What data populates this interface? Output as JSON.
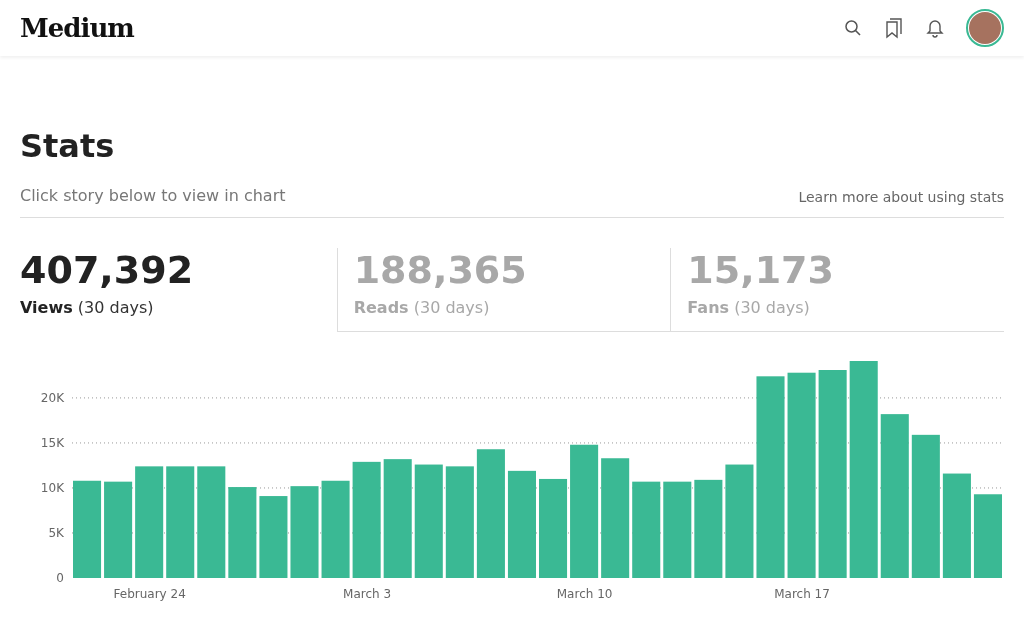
{
  "header": {
    "logo": "Medium"
  },
  "page": {
    "title": "Stats",
    "hint": "Click story below to view in chart",
    "learn_more": "Learn more about using stats"
  },
  "tabs": [
    {
      "value": "407,392",
      "label": "Views",
      "period": "(30 days)",
      "selected": true
    },
    {
      "value": "188,365",
      "label": "Reads",
      "period": "(30 days)",
      "selected": false
    },
    {
      "value": "15,173",
      "label": "Fans",
      "period": "(30 days)",
      "selected": false
    }
  ],
  "chart_data": {
    "type": "bar",
    "grid": true,
    "categories": [
      null,
      null,
      "February 24",
      null,
      null,
      null,
      null,
      null,
      null,
      "March 3",
      null,
      null,
      null,
      null,
      null,
      null,
      "March 10",
      null,
      null,
      null,
      null,
      null,
      null,
      "March 17",
      null,
      null,
      null,
      null,
      null,
      null
    ],
    "ylim": [
      0,
      24.1
    ],
    "series": [
      {
        "color": "#3ab994",
        "values": [
          10.8,
          10.7,
          12.4,
          12.4,
          12.4,
          10.1,
          9.1,
          10.2,
          10.8,
          12.9,
          13.2,
          12.6,
          12.4,
          14.3,
          11.9,
          11.0,
          14.8,
          13.3,
          10.7,
          10.7,
          10.9,
          12.6,
          22.4,
          22.8,
          23.1,
          24.1,
          18.2,
          15.9,
          11.6,
          9.3
        ]
      }
    ],
    "yticks": [
      {
        "value": 0,
        "label": "0"
      },
      {
        "value": 5,
        "label": "5K"
      },
      {
        "value": 10,
        "label": "10K"
      },
      {
        "value": 15,
        "label": "15K"
      },
      {
        "value": 20,
        "label": "20K"
      }
    ]
  }
}
